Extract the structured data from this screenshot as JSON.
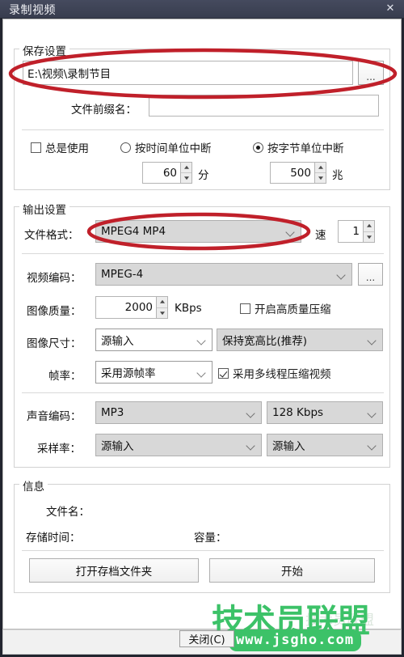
{
  "window": {
    "title": "录制视频",
    "close_icon": "close-x-icon"
  },
  "save_settings": {
    "group_title": "保存设置",
    "path_value": "E:\\视频\\录制节目",
    "browse_label": "...",
    "prefix_label": "文件前缀名：",
    "prefix_value": "",
    "always_use": {
      "label": "总是使用",
      "checked": false
    },
    "break_by_time": {
      "label": "按时间单位中断",
      "selected": false
    },
    "break_by_size": {
      "label": "按字节单位中断",
      "selected": true
    },
    "time_value": "60",
    "time_unit": "分",
    "size_value": "500",
    "size_unit": "兆"
  },
  "output_settings": {
    "group_title": "输出设置",
    "file_format_label": "文件格式：",
    "file_format_value": "MPEG4 MP4",
    "speed_label": "速",
    "speed_value": "1",
    "video_codec_label": "视频编码：",
    "video_codec_value": "MPEG-4",
    "video_codec_more": "...",
    "quality_label": "图像质量：",
    "quality_value": "2000",
    "quality_unit": "KBps",
    "hq_compress": {
      "label": "开启高质量压缩",
      "checked": false
    },
    "size_label": "图像尺寸：",
    "size_value": "源输入",
    "aspect_value": "保持宽高比(推荐)",
    "fps_label": "帧率：",
    "fps_value": "采用源帧率",
    "multithread": {
      "label": "采用多线程压缩视频",
      "checked": true
    },
    "audio_codec_label": "声音编码：",
    "audio_codec_value": "MP3",
    "audio_bitrate_value": "128 Kbps",
    "samplerate_label": "采样率：",
    "samplerate_value": "源输入",
    "channels_value": "源输入"
  },
  "info": {
    "group_title": "信息",
    "filename_label": "文件名：",
    "filename_value": "",
    "savetime_label": "存储时间：",
    "savetime_value": "",
    "capacity_label": "容量：",
    "capacity_value": "",
    "open_folder_label": "打开存档文件夹",
    "start_label": "开始"
  },
  "footer": {
    "close_label": "关闭(C)"
  },
  "watermark": {
    "brand": "技术员联盟",
    "url": "www.jsgho.com",
    "ghost": "技术员联盟",
    "color": "#3cc268"
  },
  "annotations": {
    "accent_color": "#c0202a",
    "ellipse_1": "highlight-save-path",
    "ellipse_2": "highlight-file-format"
  }
}
